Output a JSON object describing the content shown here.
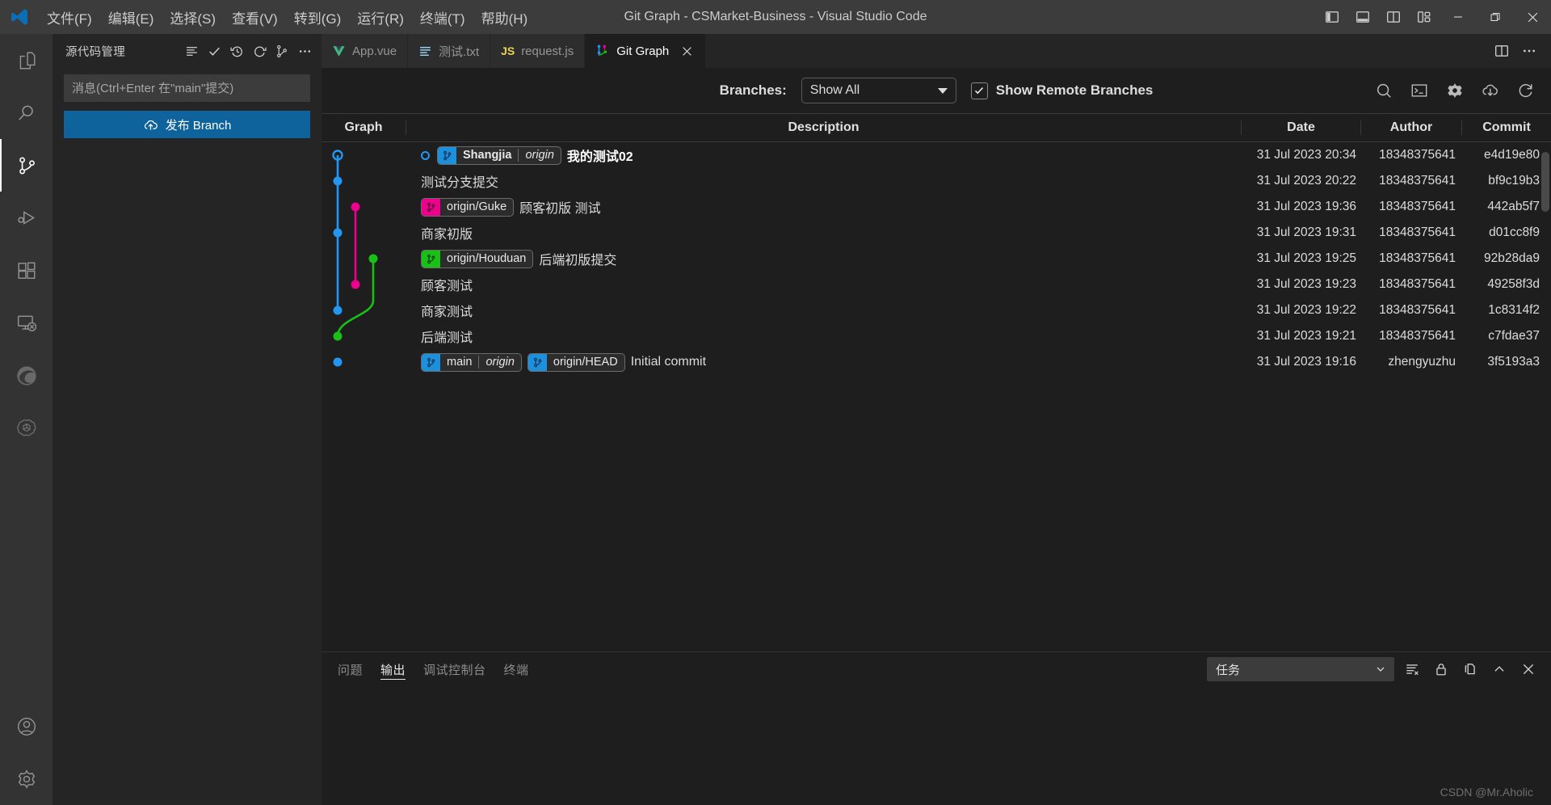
{
  "window": {
    "title": "Git Graph - CSMarket-Business - Visual Studio Code",
    "menu": [
      "文件(F)",
      "编辑(E)",
      "选择(S)",
      "查看(V)",
      "转到(G)",
      "运行(R)",
      "终端(T)",
      "帮助(H)"
    ],
    "controls": {
      "toggle_primary_sidebar": "toggle-primary-sidebar",
      "toggle_panel": "toggle-panel",
      "toggle_secondary_sidebar": "toggle-secondary-sidebar",
      "customize_layout": "customize-layout",
      "minimize": "−",
      "restore": "restore",
      "close": "✕"
    }
  },
  "activitybar": {
    "items": [
      {
        "name": "explorer",
        "icon": "files-icon",
        "active": false
      },
      {
        "name": "search",
        "icon": "search-icon",
        "active": false
      },
      {
        "name": "source-control",
        "icon": "source-control-icon",
        "active": true
      },
      {
        "name": "run-and-debug",
        "icon": "run-debug-icon",
        "active": false
      },
      {
        "name": "extensions",
        "icon": "extensions-icon",
        "active": false
      },
      {
        "name": "remote-explorer",
        "icon": "remote-icon",
        "active": false
      },
      {
        "name": "edge-browser",
        "icon": "edge-icon",
        "active": false
      },
      {
        "name": "chatgpt",
        "icon": "openai-icon",
        "active": false
      }
    ],
    "bottom": [
      {
        "name": "accounts",
        "icon": "account-icon"
      },
      {
        "name": "settings",
        "icon": "gear-icon"
      }
    ]
  },
  "sidebar": {
    "title": "源代码管理",
    "actions": [
      "view-as-list-icon",
      "commit-check-icon",
      "history-icon",
      "refresh-icon",
      "git-graph-icon",
      "more-actions-icon"
    ],
    "commit_input_placeholder": "消息(Ctrl+Enter 在\"main\"提交)",
    "commit_input_value": "",
    "publish_button": "发布 Branch"
  },
  "tabs": [
    {
      "label": "App.vue",
      "icon": "vue-icon",
      "active": false,
      "closable": false
    },
    {
      "label": "测试.txt",
      "icon": "text-file-icon",
      "active": false,
      "closable": false
    },
    {
      "label": "request.js",
      "icon": "js-icon",
      "active": false,
      "closable": false
    },
    {
      "label": "Git Graph",
      "icon": "git-graph-icon",
      "active": true,
      "closable": true
    }
  ],
  "tabs_right_actions": [
    "split-editor-icon",
    "more-actions-icon"
  ],
  "gitgraph": {
    "branches_label": "Branches:",
    "branches_value": "Show All",
    "show_remote_branches_label": "Show Remote Branches",
    "show_remote_branches_checked": true,
    "tools": [
      "search-icon",
      "terminal-icon",
      "gear-icon",
      "fetch-icon",
      "refresh-icon"
    ],
    "columns": [
      "Graph",
      "Description",
      "Date",
      "Author",
      "Commit"
    ],
    "colors": {
      "blue": "#2196f3",
      "magenta": "#ec008c",
      "green": "#19c016",
      "ref_blue": "#1c8fdd"
    },
    "commits": [
      {
        "head": true,
        "refs": [
          {
            "name": "Shangjia",
            "sub": "origin",
            "color": "#1c8fdd",
            "bold": true
          }
        ],
        "message": "我的测试02",
        "message_bold": true,
        "date": "31 Jul 2023 20:34",
        "author": "18348375641",
        "commit": "e4d19e80"
      },
      {
        "head": false,
        "refs": [],
        "message": "测试分支提交",
        "message_bold": false,
        "date": "31 Jul 2023 20:22",
        "author": "18348375641",
        "commit": "bf9c19b3"
      },
      {
        "head": false,
        "refs": [
          {
            "name": "origin/Guke",
            "sub": "",
            "color": "#ec008c",
            "bold": false
          }
        ],
        "message": "顾客初版 测试",
        "message_bold": false,
        "date": "31 Jul 2023 19:36",
        "author": "18348375641",
        "commit": "442ab5f7"
      },
      {
        "head": false,
        "refs": [],
        "message": "商家初版",
        "message_bold": false,
        "date": "31 Jul 2023 19:31",
        "author": "18348375641",
        "commit": "d01cc8f9"
      },
      {
        "head": false,
        "refs": [
          {
            "name": "origin/Houduan",
            "sub": "",
            "color": "#19c016",
            "bold": false
          }
        ],
        "message": "后端初版提交",
        "message_bold": false,
        "date": "31 Jul 2023 19:25",
        "author": "18348375641",
        "commit": "92b28da9"
      },
      {
        "head": false,
        "refs": [],
        "message": "顾客测试",
        "message_bold": false,
        "date": "31 Jul 2023 19:23",
        "author": "18348375641",
        "commit": "49258f3d"
      },
      {
        "head": false,
        "refs": [],
        "message": "商家测试",
        "message_bold": false,
        "date": "31 Jul 2023 19:22",
        "author": "18348375641",
        "commit": "1c8314f2"
      },
      {
        "head": false,
        "refs": [],
        "message": "后端测试",
        "message_bold": false,
        "date": "31 Jul 2023 19:21",
        "author": "18348375641",
        "commit": "c7fdae37"
      },
      {
        "head": false,
        "refs": [
          {
            "name": "main",
            "sub": "origin",
            "color": "#1c8fdd",
            "bold": false
          },
          {
            "name": "origin/HEAD",
            "sub": "",
            "color": "#1c8fdd",
            "bold": false
          }
        ],
        "message": "Initial commit",
        "message_bold": false,
        "date": "31 Jul 2023 19:16",
        "author": "zhengyuzhu",
        "commit": "3f5193a3"
      }
    ]
  },
  "panel": {
    "tabs": [
      {
        "label": "问题",
        "active": false
      },
      {
        "label": "输出",
        "active": true
      },
      {
        "label": "调试控制台",
        "active": false
      },
      {
        "label": "终端",
        "active": false
      }
    ],
    "channel_value": "任务",
    "actions": [
      "clear-output-icon",
      "lock-icon",
      "open-in-editor-icon",
      "chevron-up-icon",
      "close-icon"
    ]
  },
  "watermark": "CSDN @Mr.Aholic"
}
